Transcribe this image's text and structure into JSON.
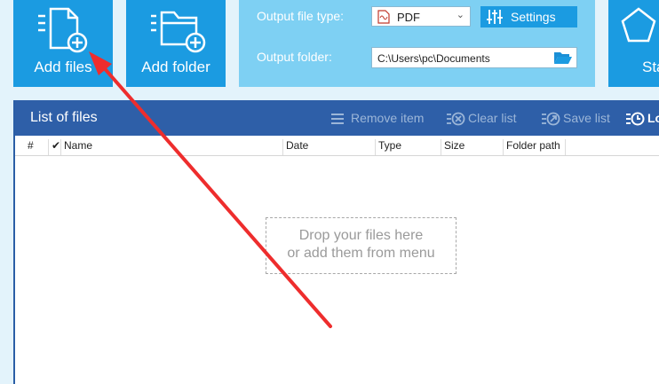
{
  "toolbar": {
    "add_files_label": "Add files",
    "add_folder_label": "Add folder",
    "start_label": "Sta"
  },
  "options": {
    "output_type_label": "Output file type:",
    "output_type_value": "PDF",
    "settings_label": "Settings",
    "output_folder_label": "Output folder:",
    "output_folder_value": "C:\\Users\\pc\\Documents"
  },
  "files": {
    "title": "List of files",
    "actions": {
      "remove_item": "Remove item",
      "clear_list": "Clear list",
      "save_list": "Save list",
      "load_list": "Lo"
    },
    "columns": {
      "num": "#",
      "check": "✔",
      "name": "Name",
      "date": "Date",
      "type": "Type",
      "size": "Size",
      "folder_path": "Folder path"
    },
    "drop_zone": {
      "line1": "Drop your files here",
      "line2": "or add them from menu"
    }
  },
  "icons": {
    "add_files": "add-file-icon",
    "add_folder": "add-folder-icon",
    "start": "start-icon",
    "pdf": "pdf-file-icon",
    "settings": "sliders-icon",
    "browse": "open-folder-icon"
  },
  "colors": {
    "tile_blue": "#1b9be1",
    "panel_light_blue": "#7ed0f3",
    "header_dark_blue": "#2e5fa8",
    "annotation_red": "#ee2d2d"
  }
}
